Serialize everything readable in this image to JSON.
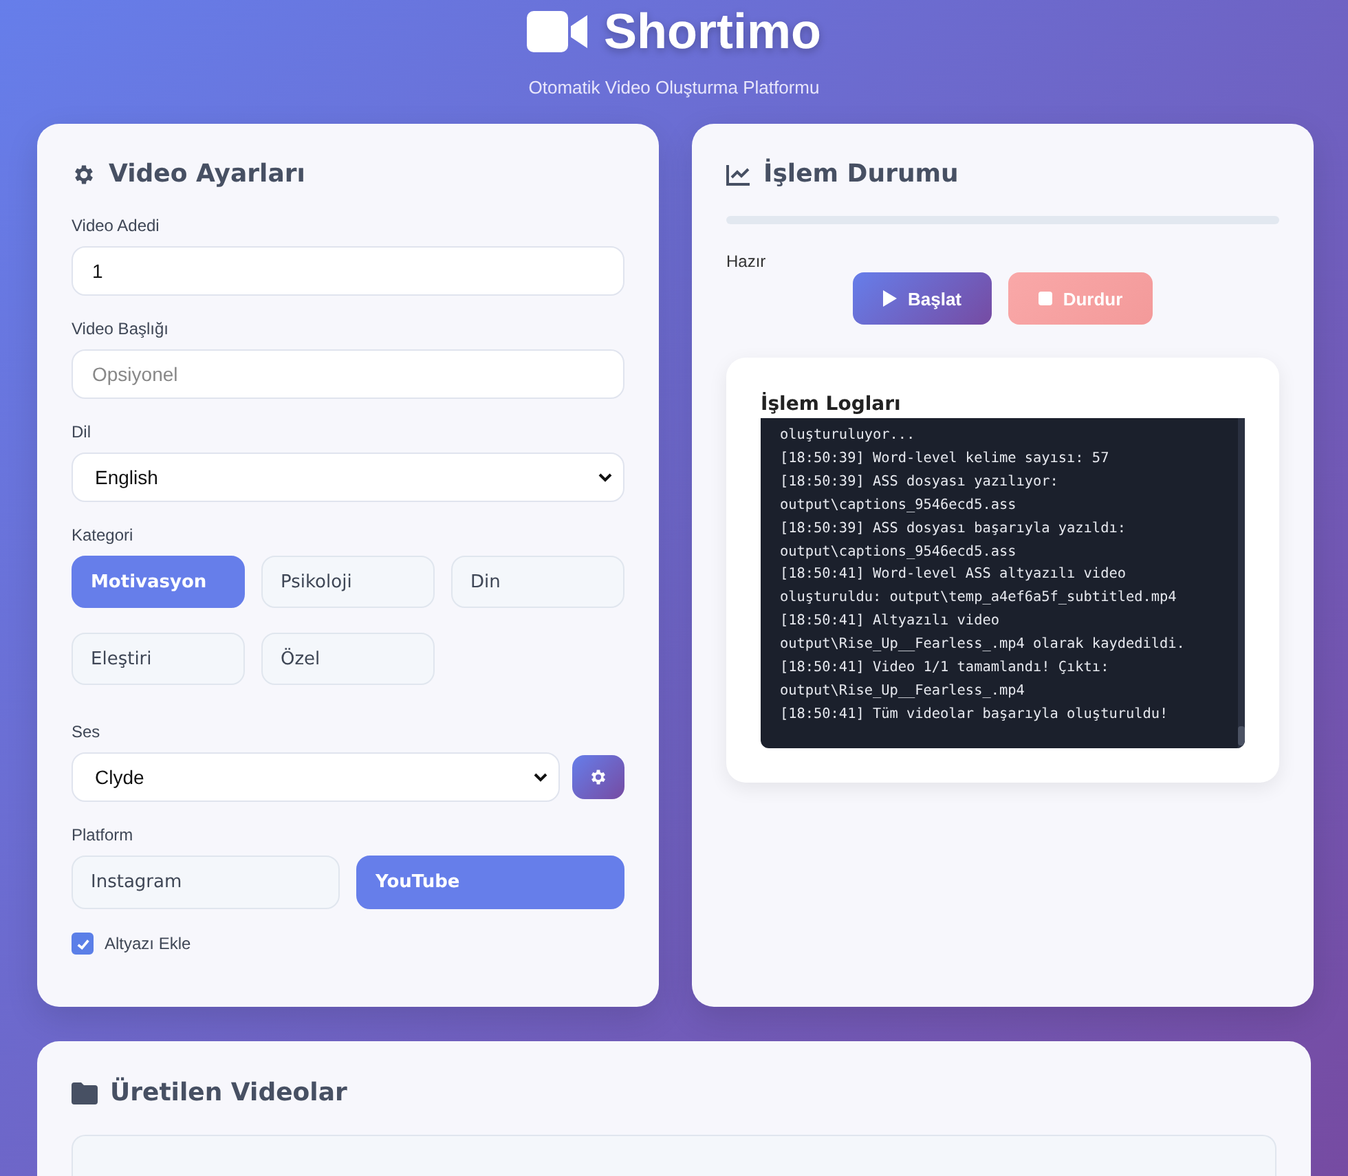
{
  "header": {
    "title": "Shortimo",
    "subtitle": "Otomatik Video Oluşturma Platformu"
  },
  "settings": {
    "title": "Video Ayarları",
    "video_count": {
      "label": "Video Adedi",
      "value": "1"
    },
    "video_title": {
      "label": "Video Başlığı",
      "placeholder": "Opsiyonel"
    },
    "language": {
      "label": "Dil",
      "value": "English"
    },
    "category": {
      "label": "Kategori",
      "options": [
        {
          "label": "Motivasyon",
          "selected": true
        },
        {
          "label": "Psikoloji",
          "selected": false
        },
        {
          "label": "Din",
          "selected": false
        },
        {
          "label": "Eleştiri",
          "selected": false
        },
        {
          "label": "Özel",
          "selected": false
        }
      ]
    },
    "voice": {
      "label": "Ses",
      "value": "Clyde"
    },
    "platform": {
      "label": "Platform",
      "options": [
        {
          "label": "Instagram",
          "selected": false
        },
        {
          "label": "YouTube",
          "selected": true
        }
      ]
    },
    "subtitles": {
      "label": "Altyazı Ekle",
      "checked": true
    }
  },
  "status": {
    "title": "İşlem Durumu",
    "progress": {
      "level": 0
    },
    "state": "Hazır",
    "buttons": [
      {
        "kind": "start",
        "label": "Başlat"
      },
      {
        "kind": "stop",
        "label": "Durdur"
      }
    ],
    "logs": {
      "title": "İşlem Logları",
      "entries": [
        "oluşturuluyor...",
        "[18:50:39] Word-level kelime sayısı: 57",
        "[18:50:39] ASS dosyası yazılıyor: output\\captions_9546ecd5.ass",
        "[18:50:39] ASS dosyası başarıyla yazıldı: output\\captions_9546ecd5.ass",
        "[18:50:41] Word-level ASS altyazılı video oluşturuldu: output\\temp_a4ef6a5f_subtitled.mp4",
        "[18:50:41] Altyazılı video output\\Rise_Up__Fearless_.mp4 olarak kaydedildi.",
        "[18:50:41] Video 1/1 tamamlandı! Çıktı: output\\Rise_Up__Fearless_.mp4",
        "[18:50:41] Tüm videolar başarıyla oluşturuldu!"
      ]
    }
  },
  "videos": {
    "title": "Üretilen Videolar"
  }
}
